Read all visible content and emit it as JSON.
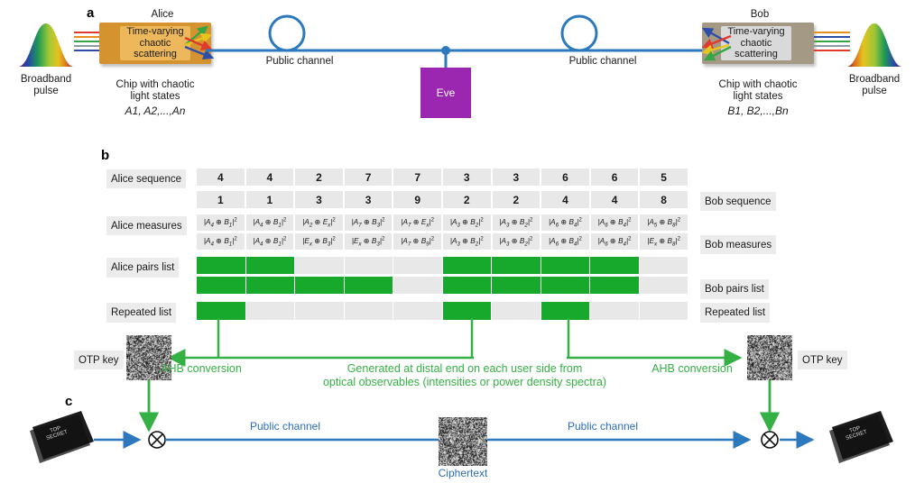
{
  "figure": {
    "panels": [
      "a",
      "b",
      "c"
    ]
  },
  "panel_a": {
    "letter": "a",
    "alice": {
      "title": "Alice",
      "inner_text": "Time-varying chaotic scattering",
      "caption_line1": "Chip with chaotic",
      "caption_line2": "light states",
      "states": "A1, A2,...,An",
      "chip_color": "#D4932F",
      "inner_color": "#EDB75B"
    },
    "bob": {
      "title": "Bob",
      "inner_text": "Time-varying chaotic scattering",
      "caption_line1": "Chip with chaotic",
      "caption_line2": "light states",
      "states": "B1, B2,...,Bn",
      "chip_color": "#A49984",
      "inner_color": "#D9D9D9"
    },
    "left_pulse": {
      "line1": "Broadband",
      "line2": "pulse"
    },
    "right_pulse": {
      "line1": "Broadband",
      "line2": "pulse"
    },
    "channel_left_label": "Public channel",
    "channel_right_label": "Public channel",
    "eve": {
      "label": "Eve",
      "color": "#9B27B0"
    },
    "channel_color": "#2c79bd"
  },
  "panel_b": {
    "letter": "b",
    "row_labels": {
      "alice_sequence": "Alice sequence",
      "bob_sequence": "Bob sequence",
      "alice_measures": "Alice measures",
      "bob_measures": "Bob measures",
      "alice_pairs": "Alice pairs list",
      "bob_pairs": "Bob pairs list",
      "repeated_left": "Repeated list",
      "repeated_right": "Repeated list"
    },
    "alice_sequence": [
      4,
      4,
      2,
      7,
      7,
      3,
      3,
      6,
      6,
      5
    ],
    "bob_sequence": [
      1,
      1,
      3,
      3,
      9,
      2,
      2,
      4,
      4,
      8
    ],
    "alice_measures": [
      {
        "a": "A",
        "as": "4",
        "b": "B",
        "bs": "1"
      },
      {
        "a": "A",
        "as": "4",
        "b": "B",
        "bs": "1"
      },
      {
        "a": "A",
        "as": "2",
        "b": "E",
        "bs": "x"
      },
      {
        "a": "A",
        "as": "7",
        "b": "B",
        "bs": "3"
      },
      {
        "a": "A",
        "as": "7",
        "b": "E",
        "bs": "x"
      },
      {
        "a": "A",
        "as": "3",
        "b": "B",
        "bs": "2"
      },
      {
        "a": "A",
        "as": "3",
        "b": "B",
        "bs": "2"
      },
      {
        "a": "A",
        "as": "6",
        "b": "B",
        "bs": "4"
      },
      {
        "a": "A",
        "as": "6",
        "b": "B",
        "bs": "4"
      },
      {
        "a": "A",
        "as": "5",
        "b": "B",
        "bs": "8"
      }
    ],
    "bob_measures": [
      {
        "a": "A",
        "as": "4",
        "b": "B",
        "bs": "1"
      },
      {
        "a": "A",
        "as": "4",
        "b": "B",
        "bs": "1"
      },
      {
        "a": "E",
        "as": "x",
        "b": "B",
        "bs": "3"
      },
      {
        "a": "E",
        "as": "x",
        "b": "B",
        "bs": "3"
      },
      {
        "a": "A",
        "as": "7",
        "b": "B",
        "bs": "9"
      },
      {
        "a": "A",
        "as": "3",
        "b": "B",
        "bs": "2"
      },
      {
        "a": "A",
        "as": "3",
        "b": "B",
        "bs": "2"
      },
      {
        "a": "A",
        "as": "6",
        "b": "B",
        "bs": "4"
      },
      {
        "a": "A",
        "as": "6",
        "b": "B",
        "bs": "4"
      },
      {
        "a": "E",
        "as": "x",
        "b": "B",
        "bs": "8"
      }
    ],
    "alice_pairs_list": [
      1,
      1,
      0,
      0,
      0,
      1,
      1,
      1,
      1,
      0
    ],
    "bob_pairs_list": [
      1,
      1,
      1,
      1,
      0,
      1,
      1,
      1,
      1,
      0
    ],
    "repeated_list": [
      1,
      0,
      0,
      0,
      0,
      1,
      0,
      1,
      0,
      0
    ],
    "green_color": "#16a92c",
    "gray_color": "#e8e8e8",
    "otp_left": "OTP key",
    "otp_right": "OTP key",
    "ahb_left": "AHB conversion",
    "ahb_right": "AHB conversion",
    "generated_note_line1": "Generated at distal end on each user side from",
    "generated_note_line2": "optical observables (intensities or power density spectra)"
  },
  "panel_c": {
    "letter": "c",
    "doc_label": "TOP SECRET",
    "xor_symbol": "⊗",
    "channel_left_label": "Public channel",
    "channel_right_label": "Public channel",
    "ciphertext_label": "Ciphertext",
    "channel_color": "#2c79bd"
  }
}
